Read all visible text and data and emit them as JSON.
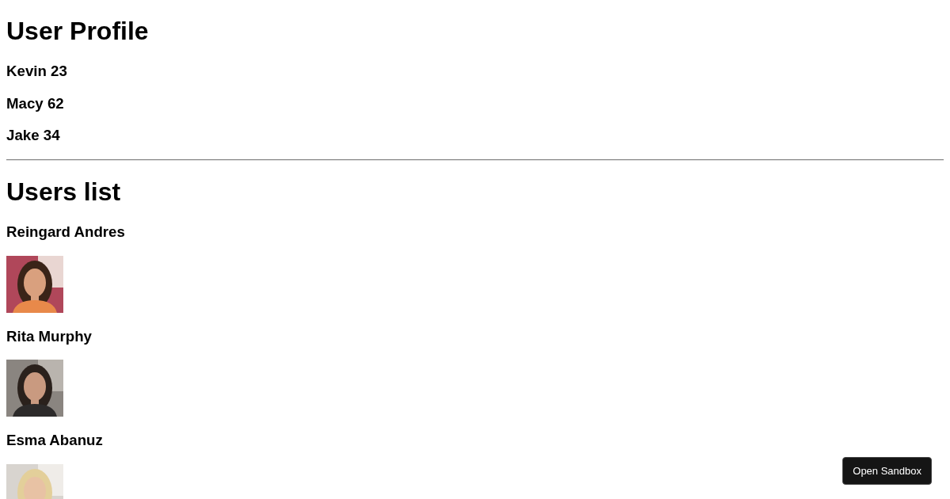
{
  "profile": {
    "title": "User Profile",
    "people": [
      {
        "text": "Kevin 23"
      },
      {
        "text": "Macy 62"
      },
      {
        "text": "Jake 34"
      }
    ]
  },
  "users": {
    "title": "Users list",
    "items": [
      {
        "name": "Reingard Andres"
      },
      {
        "name": "Rita Murphy"
      },
      {
        "name": "Esma Abanuz"
      }
    ]
  },
  "sandbox_button": "Open Sandbox"
}
